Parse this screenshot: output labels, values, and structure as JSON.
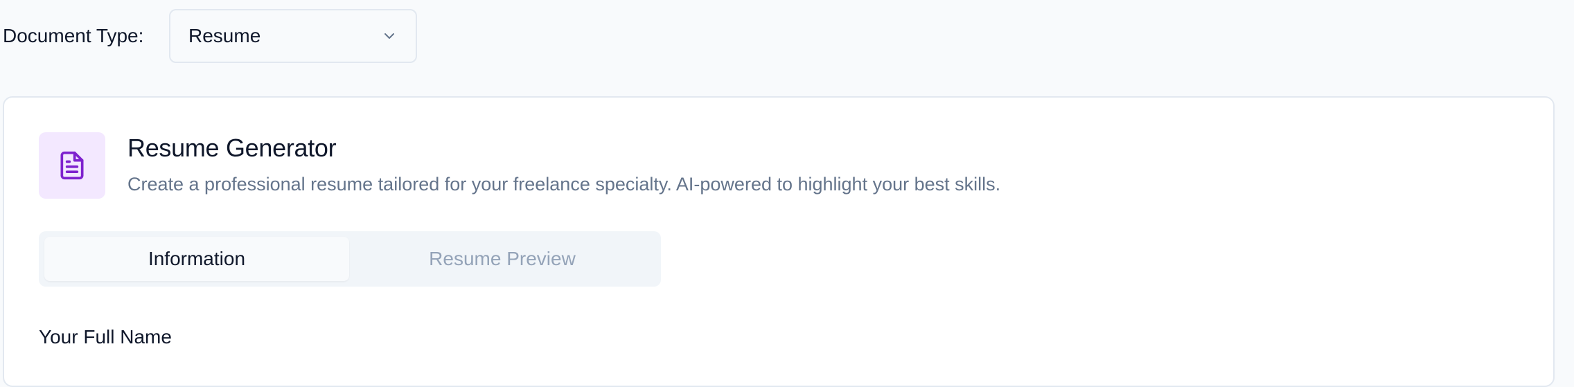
{
  "document_type": {
    "label": "Document Type:",
    "selected": "Resume",
    "chevron_icon": "chevron-down-icon"
  },
  "card": {
    "icon": "document-icon",
    "title": "Resume Generator",
    "description": "Create a professional resume tailored for your freelance specialty. AI-powered to highlight your best skills.",
    "icon_color": "#7e22ce",
    "icon_bg": "#f3e8ff"
  },
  "tabs": [
    {
      "label": "Information",
      "active": true
    },
    {
      "label": "Resume Preview",
      "active": false
    }
  ],
  "form": {
    "full_name_label": "Your Full Name"
  }
}
